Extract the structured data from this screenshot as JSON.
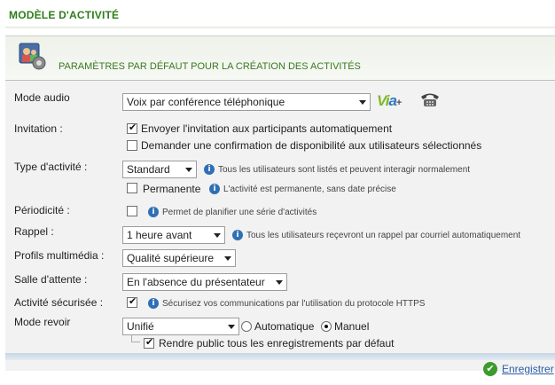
{
  "page": {
    "title": "MODÈLE D'ACTIVITÉ"
  },
  "panel": {
    "header": "PARAMÈTRES PAR DÉFAUT POUR LA CRÉATION DES ACTIVITÉS"
  },
  "form": {
    "mode_audio": {
      "label": "Mode audio",
      "value": "Voix par conférence téléphonique",
      "logo_text_v": "Vi",
      "logo_text_a": "a",
      "logo_plus": "+"
    },
    "invitation": {
      "label": "Invitation :",
      "opt1": {
        "checked": true,
        "text": "Envoyer l'invitation aux participants automatiquement"
      },
      "opt2": {
        "checked": false,
        "text": "Demander une confirmation de disponibilité aux utilisateurs sélectionnés"
      }
    },
    "type_activite": {
      "label": "Type d'activité :",
      "value": "Standard",
      "hint": "Tous les utilisateurs sont listés et peuvent interagir normalement",
      "permanente": {
        "checked": false,
        "text": "Permanente",
        "hint": "L'activité est permanente, sans date précise"
      }
    },
    "periodicite": {
      "label": "Périodicité :",
      "checked": false,
      "hint": "Permet de planifier une série d'activités"
    },
    "rappel": {
      "label": "Rappel :",
      "value": "1 heure avant",
      "hint": "Tous les utilisateurs reçevront un rappel par courriel automatiquement"
    },
    "profils": {
      "label": "Profils multimédia :",
      "value": "Qualité supérieure"
    },
    "salle": {
      "label": "Salle d'attente :",
      "value": "En l'absence du présentateur"
    },
    "securisee": {
      "label": "Activité sécurisée :",
      "checked": true,
      "hint": "Sécurisez vos communications par l'utilisation du protocole HTTPS"
    },
    "mode_revoir": {
      "label": "Mode revoir",
      "value": "Unifié",
      "radio_auto": {
        "selected": false,
        "text": "Automatique"
      },
      "radio_manuel": {
        "selected": true,
        "text": "Manuel"
      },
      "public": {
        "checked": true,
        "text": "Rendre public tous les enregistrements par défaut"
      }
    }
  },
  "footer": {
    "save_label": "Enregistrer"
  },
  "icons": {
    "info": "info-icon",
    "save": "checkmark-icon",
    "header": "settings-people-icon",
    "phone": "telephone-icon"
  },
  "colors": {
    "title_green": "#2e7d1a",
    "link_blue": "#2a5ea8",
    "info_blue": "#2f6fb5"
  }
}
